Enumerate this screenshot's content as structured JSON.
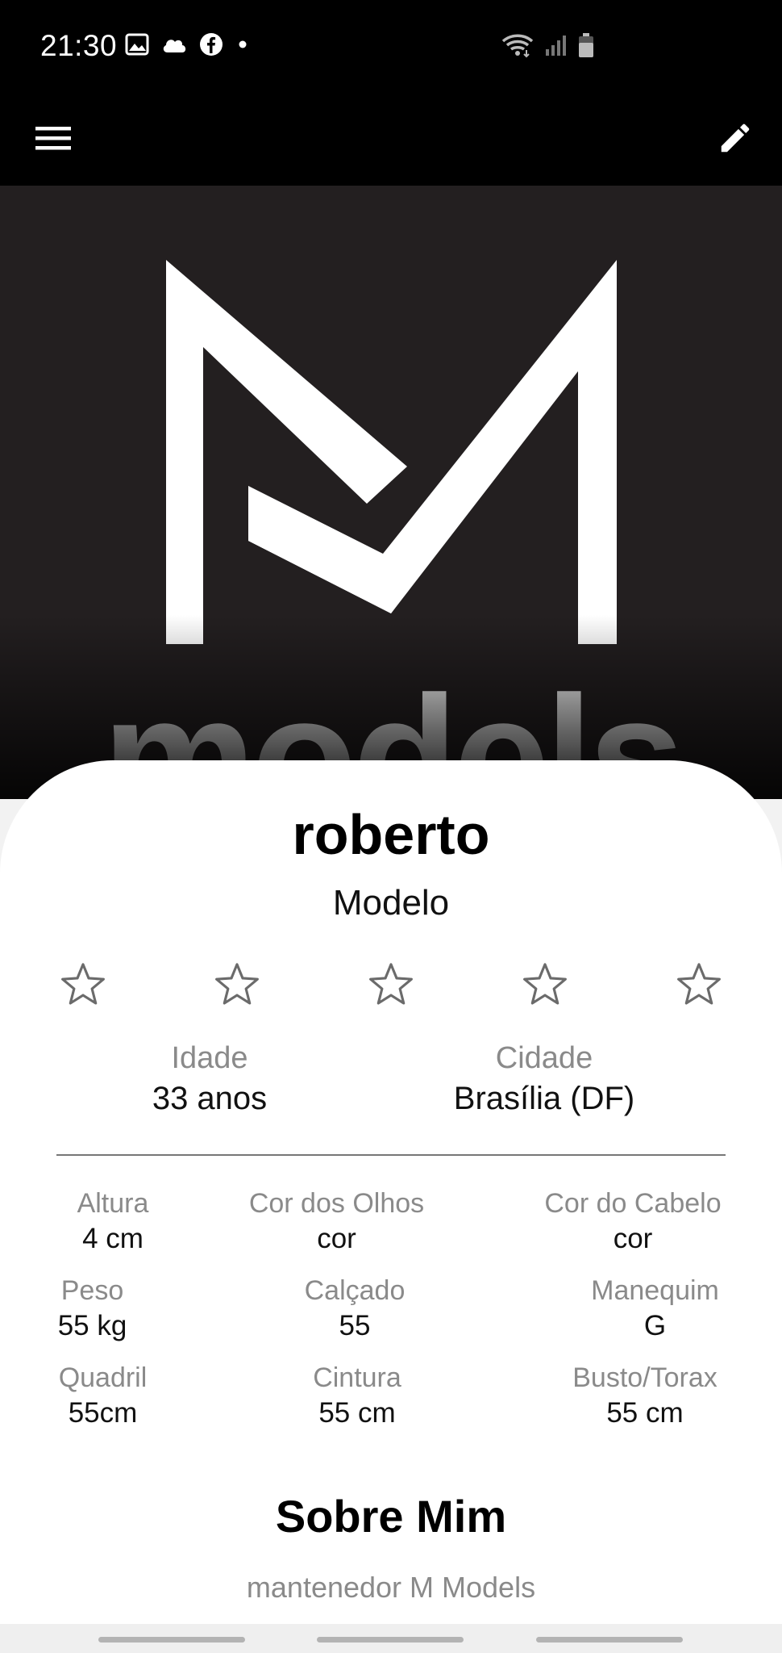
{
  "status_bar": {
    "time": "21:30",
    "left_icons": [
      "image-icon",
      "cloud-icon",
      "facebook-icon",
      "dot-icon"
    ],
    "right_icons": [
      "wifi-icon",
      "signal-icon",
      "battery-icon"
    ]
  },
  "app_bar": {
    "menu_icon": "hamburger-menu-icon",
    "edit_icon": "pencil-icon"
  },
  "hero": {
    "brand_text": "models",
    "logo_icon": "m-logo-icon"
  },
  "profile": {
    "name": "roberto",
    "role": "Modelo",
    "rating": 0,
    "rating_max": 5,
    "idade_label": "Idade",
    "idade_value": "33 anos",
    "cidade_label": "Cidade",
    "cidade_value": "Brasília (DF)"
  },
  "attributes": {
    "altura_label": "Altura",
    "altura_value": "4 cm",
    "olhos_label": "Cor dos Olhos",
    "olhos_value": "cor",
    "cabelo_label": "Cor do Cabelo",
    "cabelo_value": "cor",
    "peso_label": "Peso",
    "peso_value": "55 kg",
    "calcado_label": "Calçado",
    "calcado_value": "55",
    "manequim_label": "Manequim",
    "manequim_value": "G",
    "quadril_label": "Quadril",
    "quadril_value": "55cm",
    "cintura_label": "Cintura",
    "cintura_value": "55 cm",
    "busto_label": "Busto/Torax",
    "busto_value": "55 cm"
  },
  "about": {
    "title": "Sobre Mim",
    "text": "mantenedor M Models"
  },
  "colors": {
    "background_dark": "#000000",
    "hero_bg": "#231f20",
    "card_bg": "#ffffff",
    "label_gray": "#8a8a8a"
  }
}
